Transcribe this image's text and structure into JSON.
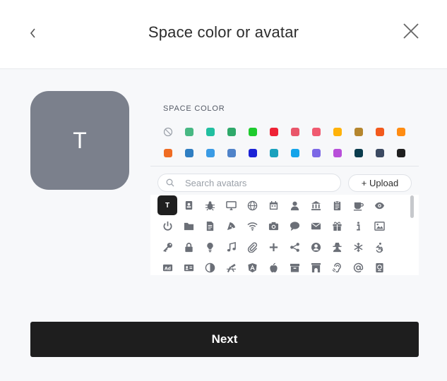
{
  "header": {
    "title": "Space color or avatar"
  },
  "preview": {
    "letter": "T",
    "color": "#7b808c"
  },
  "colors": {
    "label": "SPACE COLOR",
    "row1": [
      "none",
      "#48b883",
      "#22bfa0",
      "#2fa96a",
      "#1ecb2e",
      "#ee2336",
      "#e9566a",
      "#f05a70",
      "#ffb20a",
      "#b5862e",
      "#f25a1d",
      "#ff8c12"
    ],
    "row2": [
      "#ef6c23",
      "#2f7ec2",
      "#3a9be5",
      "#5083c9",
      "#1b22d6",
      "#1aa1bd",
      "#14a4ea",
      "#7c68e6",
      "#b84fd9",
      "#0b3c4d",
      "#3c4a62",
      "#1f1f1f"
    ]
  },
  "search": {
    "placeholder": "Search avatars"
  },
  "upload": {
    "label": "+ Upload"
  },
  "avatars": {
    "selected_letter": "T",
    "rows": [
      [
        "letter-t",
        "contact-card-icon",
        "bug-icon",
        "monitor-icon",
        "globe-icon",
        "calendar-icon",
        "user-icon",
        "bank-icon",
        "clipboard-icon",
        "coffee-icon",
        "eye-icon"
      ],
      [
        "power-icon",
        "folder-icon",
        "document-icon",
        "pizza-icon",
        "wifi-icon",
        "camera-icon",
        "chat-icon",
        "mail-icon",
        "gift-icon",
        "info-icon",
        "image-icon"
      ],
      [
        "key-icon",
        "lock-icon",
        "lightbulb-icon",
        "music-icon",
        "paperclip-icon",
        "plus-icon",
        "share-icon",
        "user-circle-icon",
        "user-secret-icon",
        "snowflake-icon",
        "accessibility-icon"
      ],
      [
        "ad-icon",
        "id-card-icon",
        "contrast-icon",
        "drafting-icon",
        "angular-icon",
        "apple-icon",
        "archive-icon",
        "archway-icon",
        "hearing-icon",
        "at-icon",
        "passport-icon"
      ]
    ]
  },
  "next": {
    "label": "Next"
  }
}
